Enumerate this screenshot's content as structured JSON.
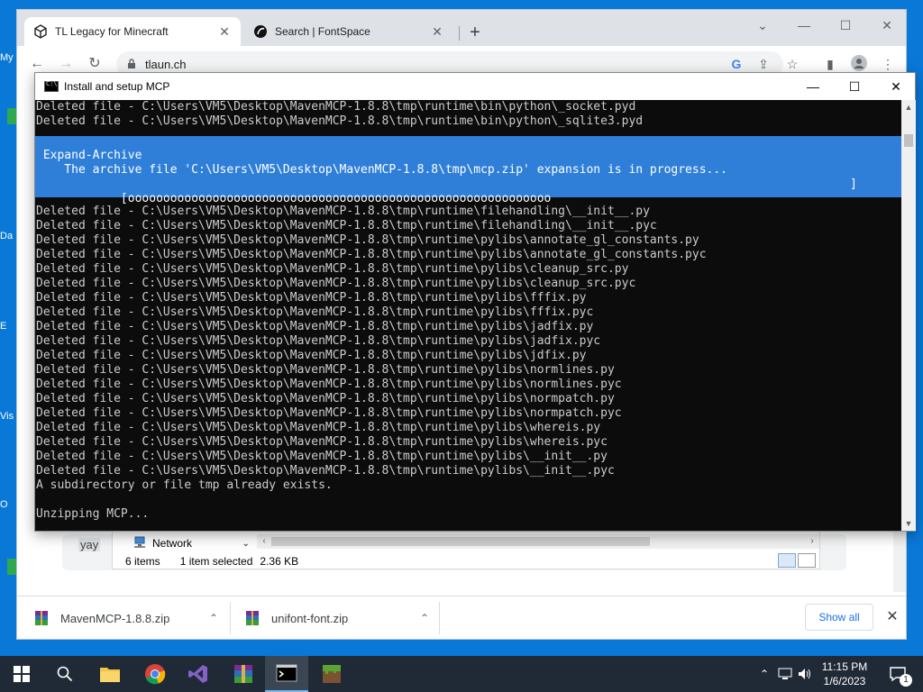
{
  "desktop": {
    "labels": [
      "My",
      "Da",
      "E",
      "Vis",
      "O"
    ]
  },
  "chrome": {
    "tabs": [
      {
        "label": "TL Legacy for Minecraft",
        "close": "✕",
        "active": true
      },
      {
        "label": "Search | FontSpace",
        "close": "✕",
        "active": false
      }
    ],
    "new_tab": "+",
    "url": "tlaun.ch",
    "page": {
      "card_text": "yay"
    }
  },
  "console": {
    "title": "Install and setup MCP",
    "lines_before": [
      "Deleted file - C:\\Users\\VM5\\Desktop\\MavenMCP-1.8.8\\tmp\\runtime\\bin\\python\\_socket.pyd",
      "Deleted file - C:\\Users\\VM5\\Desktop\\MavenMCP-1.8.8\\tmp\\runtime\\bin\\python\\_sqlite3.pyd"
    ],
    "progress": {
      "heading": " Expand-Archive",
      "message": "    The archive file 'C:\\Users\\VM5\\Desktop\\MavenMCP-1.8.8\\tmp\\mcp.zip' expansion is in progress...",
      "bar": "    [oooooooooooooooooooooooooooooooooooooooooooooooooooooooooooo",
      "bar_end": "]"
    },
    "lines_after": [
      "Deleted file - C:\\Users\\VM5\\Desktop\\MavenMCP-1.8.8\\tmp\\runtime\\filehandling\\__init__.py",
      "Deleted file - C:\\Users\\VM5\\Desktop\\MavenMCP-1.8.8\\tmp\\runtime\\filehandling\\__init__.pyc",
      "Deleted file - C:\\Users\\VM5\\Desktop\\MavenMCP-1.8.8\\tmp\\runtime\\pylibs\\annotate_gl_constants.py",
      "Deleted file - C:\\Users\\VM5\\Desktop\\MavenMCP-1.8.8\\tmp\\runtime\\pylibs\\annotate_gl_constants.pyc",
      "Deleted file - C:\\Users\\VM5\\Desktop\\MavenMCP-1.8.8\\tmp\\runtime\\pylibs\\cleanup_src.py",
      "Deleted file - C:\\Users\\VM5\\Desktop\\MavenMCP-1.8.8\\tmp\\runtime\\pylibs\\cleanup_src.pyc",
      "Deleted file - C:\\Users\\VM5\\Desktop\\MavenMCP-1.8.8\\tmp\\runtime\\pylibs\\fffix.py",
      "Deleted file - C:\\Users\\VM5\\Desktop\\MavenMCP-1.8.8\\tmp\\runtime\\pylibs\\fffix.pyc",
      "Deleted file - C:\\Users\\VM5\\Desktop\\MavenMCP-1.8.8\\tmp\\runtime\\pylibs\\jadfix.py",
      "Deleted file - C:\\Users\\VM5\\Desktop\\MavenMCP-1.8.8\\tmp\\runtime\\pylibs\\jadfix.pyc",
      "Deleted file - C:\\Users\\VM5\\Desktop\\MavenMCP-1.8.8\\tmp\\runtime\\pylibs\\jdfix.py",
      "Deleted file - C:\\Users\\VM5\\Desktop\\MavenMCP-1.8.8\\tmp\\runtime\\pylibs\\normlines.py",
      "Deleted file - C:\\Users\\VM5\\Desktop\\MavenMCP-1.8.8\\tmp\\runtime\\pylibs\\normlines.pyc",
      "Deleted file - C:\\Users\\VM5\\Desktop\\MavenMCP-1.8.8\\tmp\\runtime\\pylibs\\normpatch.py",
      "Deleted file - C:\\Users\\VM5\\Desktop\\MavenMCP-1.8.8\\tmp\\runtime\\pylibs\\normpatch.pyc",
      "Deleted file - C:\\Users\\VM5\\Desktop\\MavenMCP-1.8.8\\tmp\\runtime\\pylibs\\whereis.py",
      "Deleted file - C:\\Users\\VM5\\Desktop\\MavenMCP-1.8.8\\tmp\\runtime\\pylibs\\whereis.pyc",
      "Deleted file - C:\\Users\\VM5\\Desktop\\MavenMCP-1.8.8\\tmp\\runtime\\pylibs\\__init__.py",
      "Deleted file - C:\\Users\\VM5\\Desktop\\MavenMCP-1.8.8\\tmp\\runtime\\pylibs\\__init__.pyc",
      "A subdirectory or file tmp already exists.",
      "",
      "Unzipping MCP..."
    ]
  },
  "explorer": {
    "nav_label": "Network",
    "status_items": "6 items",
    "status_selected": "1 item selected",
    "status_size": "2.36 KB"
  },
  "downloads": {
    "items": [
      {
        "name": "MavenMCP-1.8.8.zip"
      },
      {
        "name": "unifont-font.zip"
      }
    ],
    "show_all": "Show all"
  },
  "taskbar": {
    "time": "11:15 PM",
    "date": "1/6/2023",
    "notification_count": "1"
  },
  "colors": {
    "console_bg": "#0c0c0c",
    "console_text": "#cccccc",
    "progress_bg": "#2f7fd9",
    "taskbar_bg": "#202a36",
    "desktop_bg": "#0a78d7",
    "link_blue": "#1a73e8"
  }
}
